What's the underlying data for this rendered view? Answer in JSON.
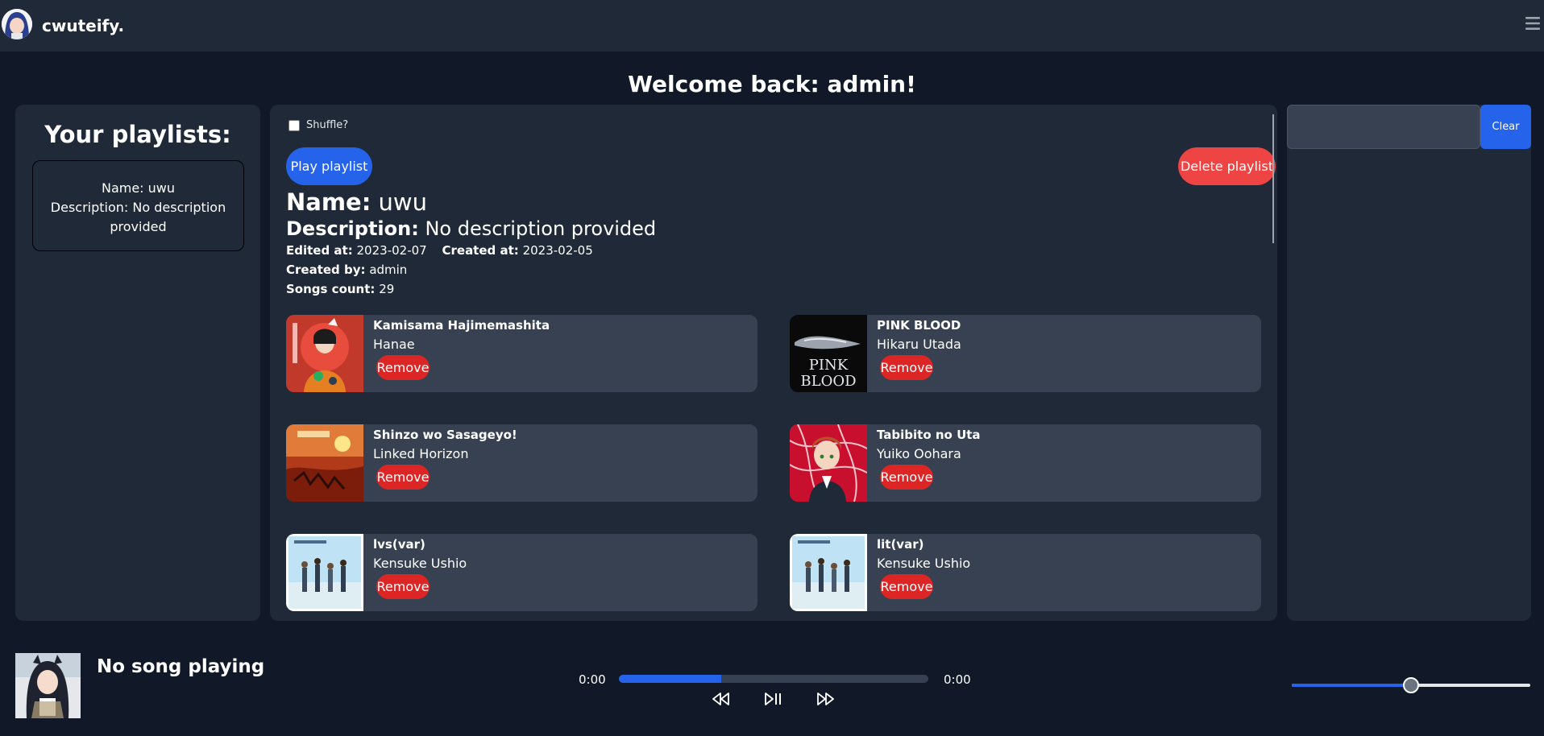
{
  "app": {
    "name": "cwuteify.",
    "menu_icon": "hamburger-menu-icon"
  },
  "welcome": "Welcome back: admin!",
  "sidebar": {
    "heading": "Your playlists:",
    "playlists": [
      {
        "name": "Name: uwu",
        "description": "Description: No description provided"
      }
    ]
  },
  "playlist": {
    "shuffle_label": "Shuffle?",
    "shuffle_checked": false,
    "play_label": "Play playlist",
    "delete_label": "Delete playlist",
    "name_label": "Name:",
    "name": "uwu",
    "description_label": "Description:",
    "description": "No description provided",
    "edited_label": "Edited at:",
    "edited": "2023-02-07",
    "created_label": "Created at:",
    "created": "2023-02-05",
    "created_by_label": "Created by:",
    "created_by": "admin",
    "songs_count_label": "Songs count:",
    "songs_count": "29",
    "remove_label": "Remove",
    "songs": [
      {
        "title": "Kamisama Hajimemashita",
        "artist": "Hanae"
      },
      {
        "title": "PINK BLOOD",
        "artist": "Hikaru Utada",
        "cover_text": "PINK BLOOD"
      },
      {
        "title": "Shinzo wo Sasageyo!",
        "artist": "Linked Horizon"
      },
      {
        "title": "Tabibito no Uta",
        "artist": "Yuiko Oohara"
      },
      {
        "title": "lvs(var)",
        "artist": "Kensuke Ushio"
      },
      {
        "title": "lit(var)",
        "artist": "Kensuke Ushio"
      }
    ]
  },
  "search": {
    "value": "",
    "clear_label": "Clear"
  },
  "player": {
    "status": "No song playing",
    "current_time": "0:00",
    "duration": "0:00",
    "progress": 0.33,
    "volume": 0.5,
    "icons": [
      "rewind-icon",
      "play-pause-icon",
      "fast-forward-icon"
    ]
  },
  "colors": {
    "accent": "#2563eb",
    "danger": "#ef4444",
    "panel": "#1f2937",
    "card": "#374151",
    "background": "#111827"
  }
}
